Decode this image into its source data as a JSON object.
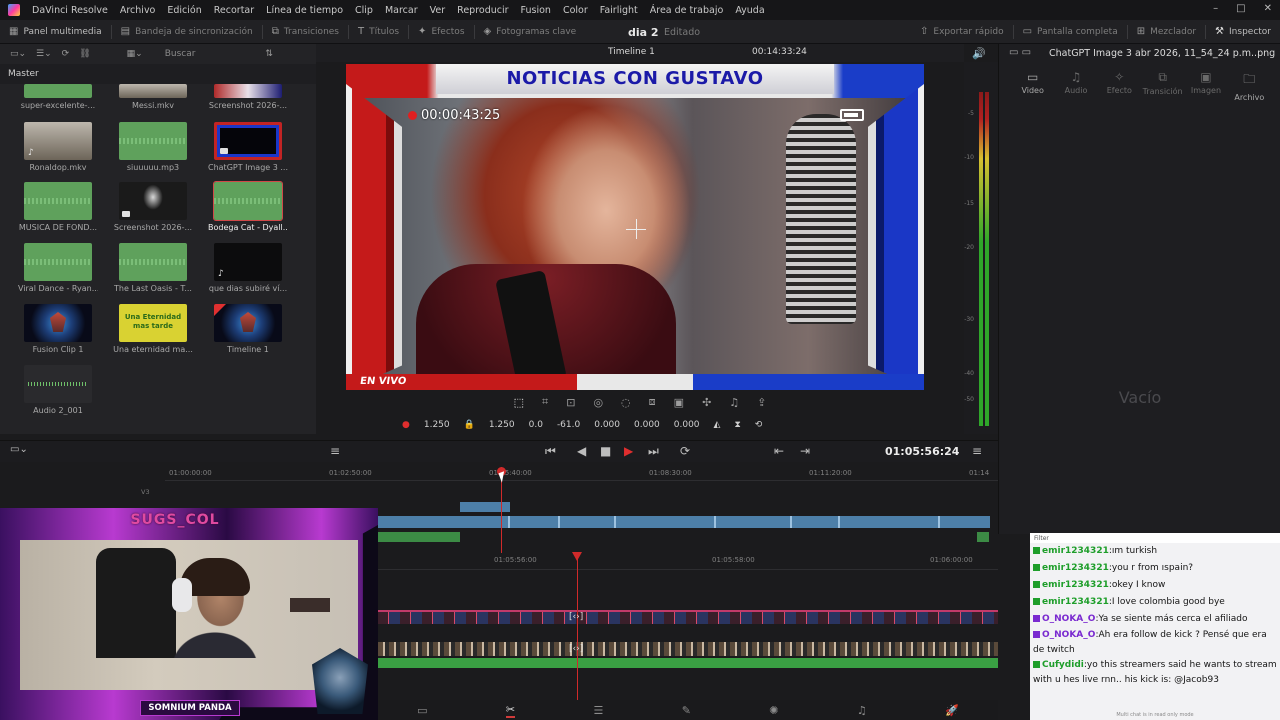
{
  "menubar": {
    "app": "DaVinci Resolve",
    "items": [
      "Archivo",
      "Edición",
      "Recortar",
      "Línea de tiempo",
      "Clip",
      "Marcar",
      "Ver",
      "Reproducir",
      "Fusion",
      "Color",
      "Fairlight",
      "Área de trabajo",
      "Ayuda"
    ]
  },
  "toolbar": {
    "left": [
      "Panel multimedia",
      "Bandeja de sincronización",
      "Transiciones",
      "Títulos",
      "Efectos",
      "Fotogramas clave"
    ],
    "project_title": "dia 2",
    "project_status": "Editado",
    "right": [
      "Exportar rápido",
      "Pantalla completa",
      "Mezclador",
      "Inspector"
    ]
  },
  "media_pool": {
    "search_placeholder": "Buscar",
    "bin": "Master",
    "clips": [
      {
        "label": "super-excelente-...",
        "kind": "audio"
      },
      {
        "label": "Messi.mkv",
        "kind": "people"
      },
      {
        "label": "Screenshot 2026-...",
        "kind": "people"
      },
      {
        "label": "Ronaldop.mkv",
        "kind": "people"
      },
      {
        "label": "siuuuuu.mp3",
        "kind": "audio"
      },
      {
        "label": "ChatGPT Image 3 ...",
        "kind": "frame"
      },
      {
        "label": "MUSICA DE FOND...",
        "kind": "audio"
      },
      {
        "label": "Screenshot 2026-...",
        "kind": "dark"
      },
      {
        "label": "Bodega Cat - Dyall...",
        "kind": "audio",
        "selected": true
      },
      {
        "label": "Viral Dance - Ryan...",
        "kind": "audio"
      },
      {
        "label": "The Last Oasis - T...",
        "kind": "audio"
      },
      {
        "label": "que dias subiré ví...",
        "kind": "dark"
      },
      {
        "label": "Fusion Clip 1",
        "kind": "logo"
      },
      {
        "label": "Una eternidad ma...",
        "kind": "yellow",
        "thumb_text": "Una Eternidad mas tarde"
      },
      {
        "label": "Timeline 1",
        "kind": "logo"
      },
      {
        "label": "Audio 2_001",
        "kind": "wave"
      }
    ]
  },
  "viewer": {
    "timeline_name": "Timeline 1",
    "timecode": "00:14:33:24",
    "overlay_title": "NOTICIAS CON GUSTAVO",
    "rec_time": "00:00:43:25",
    "live_label": "EN VIVO",
    "transform": {
      "zoom_x": "1.250",
      "zoom_y": "1.250",
      "pos_x": "0.0",
      "pos_y": "-61.0",
      "rotation": "0.000",
      "pitch": "0.000",
      "yaw": "0.000"
    }
  },
  "meter_scale": [
    "-5",
    "-10",
    "-15",
    "-20",
    "-30",
    "-40",
    "-50"
  ],
  "inspector": {
    "file": "ChatGPT Image 3 abr 2026, 11_54_24 p.m..png",
    "tabs": [
      "Video",
      "Audio",
      "Efecto",
      "Transición",
      "Imagen",
      "Archivo"
    ],
    "empty": "Vacío"
  },
  "transport": {
    "timecode": "01:05:56:24"
  },
  "timeline": {
    "ruler_top": [
      "01:00:00:00",
      "01:02:50:00",
      "01:05:40:00",
      "01:08:30:00",
      "01:11:20:00",
      "01:14"
    ],
    "ruler_bottom": [
      "01:05:56:00",
      "01:05:58:00",
      "01:06:00:00"
    ],
    "track_label": "V3",
    "progress_top": 0.43,
    "playhead_zoom_pos": 0.32
  },
  "webcam": {
    "name": "SUGS_COL",
    "tag": "SOMNIUM PANDA"
  },
  "chat": {
    "filter": "Filter",
    "messages": [
      {
        "user": "emir1234321",
        "text": "ım turkish",
        "color": "#1e9e2a",
        "badge": "kick"
      },
      {
        "user": "emir1234321",
        "text": "you r from ıspain?",
        "color": "#1e9e2a",
        "badge": "kick"
      },
      {
        "user": "emir1234321",
        "text": "okey I know",
        "color": "#1e9e2a",
        "badge": "kick"
      },
      {
        "user": "emir1234321",
        "text": "I love colombia good bye",
        "color": "#1e9e2a",
        "badge": "kick"
      },
      {
        "user": "O_NOKA_O",
        "text": "Ya se siente más cerca el afiliado",
        "color": "#7a2ad0",
        "badge": "twitch"
      },
      {
        "user": "O_NOKA_O",
        "text": "Ah era follow de kick ? Pensé que era de twitch",
        "color": "#7a2ad0",
        "badge": "twitch"
      },
      {
        "user": "Cufydidi",
        "text": "yo this streamers said he wants to stream with u hes live rnn.. his kick is: @Jacob93",
        "color": "#1e9e2a",
        "badge": "kick"
      }
    ],
    "footer": "Multi chat is in read only mode"
  }
}
